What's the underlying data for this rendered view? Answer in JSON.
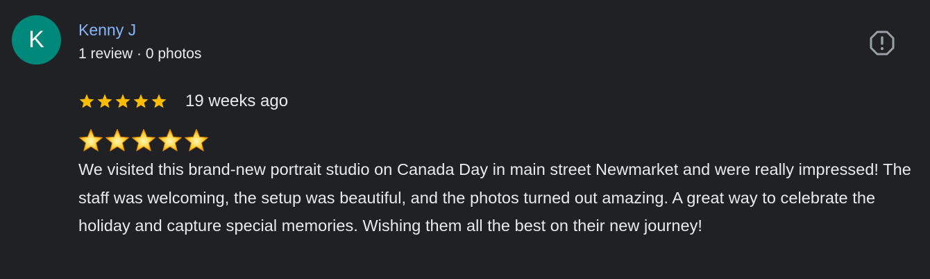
{
  "author": {
    "initial": "K",
    "name": "Kenny J",
    "meta": "1 review · 0 photos",
    "avatar_color": "#00897b",
    "name_color": "#8ab4f8"
  },
  "rating": {
    "stars": 5,
    "max": 5,
    "star_color": "#fbbc04",
    "time": "19 weeks ago"
  },
  "review": {
    "emoji_stars": 5,
    "text": "We visited this brand-new portrait studio on Canada Day in main street Newmarket and were really impressed! The staff was welcoming, the setup was beautiful, and the photos turned out amazing. A great way to celebrate the holiday and capture special memories. Wishing them all the best on their new journey!"
  },
  "icons": {
    "report": "report-flag-octagon-icon",
    "star": "star-icon",
    "emoji_star": "glowing-star-emoji-icon"
  }
}
